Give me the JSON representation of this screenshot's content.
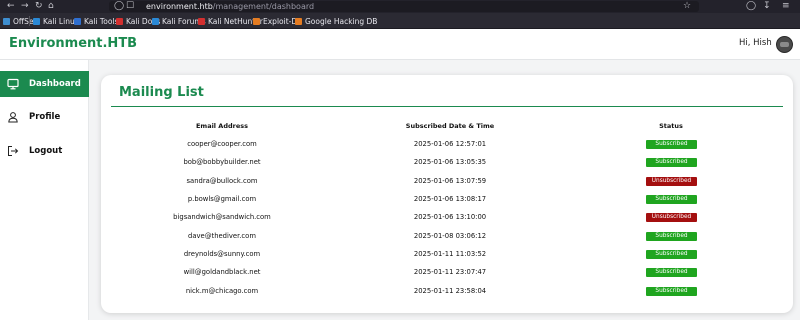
{
  "browser": {
    "url_host": "environment.htb",
    "url_path": "/management/dashboard",
    "bookmarks": [
      {
        "label": "OffSec",
        "color": "#3e8ed0"
      },
      {
        "label": "Kali Linux",
        "color": "#2b89d6"
      },
      {
        "label": "Kali Tools",
        "color": "#2f6fd0"
      },
      {
        "label": "Kali Docs",
        "color": "#d32f2f"
      },
      {
        "label": "Kali Forums",
        "color": "#2b89d6"
      },
      {
        "label": "Kali NetHunter",
        "color": "#d32f2f"
      },
      {
        "label": "Exploit-DB",
        "color": "#e57c22"
      },
      {
        "label": "Google Hacking DB",
        "color": "#e57c22"
      }
    ]
  },
  "header": {
    "brand": "Environment.HTB",
    "greeting": "Hi, Hish"
  },
  "sidebar": {
    "items": [
      {
        "label": "Dashboard",
        "icon": "monitor-icon",
        "active": true
      },
      {
        "label": "Profile",
        "icon": "user-icon",
        "active": false
      },
      {
        "label": "Logout",
        "icon": "logout-icon",
        "active": false
      }
    ]
  },
  "mailing_list": {
    "title": "Mailing List",
    "columns": [
      "Email Address",
      "Subscribed Date & Time",
      "Status"
    ],
    "rows": [
      {
        "email": "cooper@cooper.com",
        "date": "2025-01-06 12:57:01",
        "status": "Subscribed"
      },
      {
        "email": "bob@bobbybuilder.net",
        "date": "2025-01-06 13:05:35",
        "status": "Subscribed"
      },
      {
        "email": "sandra@bullock.com",
        "date": "2025-01-06 13:07:59",
        "status": "Unsubscribed"
      },
      {
        "email": "p.bowls@gmail.com",
        "date": "2025-01-06 13:08:17",
        "status": "Subscribed"
      },
      {
        "email": "bigsandwich@sandwich.com",
        "date": "2025-01-06 13:10:00",
        "status": "Unsubscribed"
      },
      {
        "email": "dave@thediver.com",
        "date": "2025-01-08 03:06:12",
        "status": "Subscribed"
      },
      {
        "email": "dreynolds@sunny.com",
        "date": "2025-01-11 11:03:52",
        "status": "Subscribed"
      },
      {
        "email": "will@goldandblack.net",
        "date": "2025-01-11 23:07:47",
        "status": "Subscribed"
      },
      {
        "email": "nick.m@chicago.com",
        "date": "2025-01-11 23:58:04",
        "status": "Subscribed"
      }
    ]
  },
  "colors": {
    "accent": "#1b8a4f",
    "subscribed": "#1fa51f",
    "unsubscribed": "#a40f0f"
  }
}
